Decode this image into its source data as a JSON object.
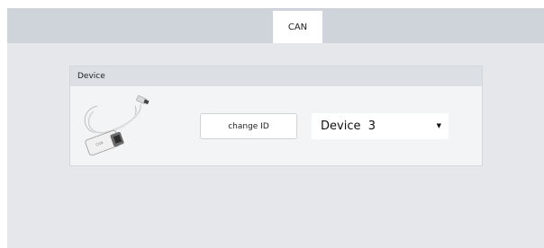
{
  "tabs": [
    {
      "label": "CAN",
      "selected": true
    }
  ],
  "device_panel": {
    "header": "Device",
    "image_icon": "usb-can-adapter-image",
    "change_id_label": "change ID",
    "device_select": {
      "selected": "Device  3"
    }
  },
  "colors": {
    "window_bg": "#e5e7eb",
    "tabbar_bg": "#cfd3da",
    "panel_header_bg": "#dcdfe4",
    "panel_bg": "#f3f4f6"
  }
}
